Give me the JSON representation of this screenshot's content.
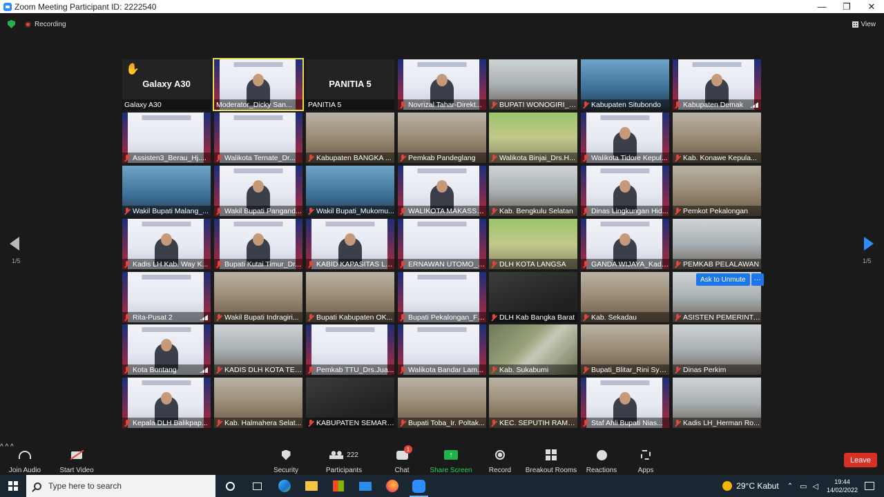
{
  "window": {
    "title": "Zoom Meeting Participant ID: 2222540",
    "minimize": "—",
    "maximize": "❐",
    "close": "✕"
  },
  "topbar": {
    "recording": "Recording",
    "view": "View"
  },
  "tiles": [
    {
      "name": "Galaxy A30",
      "center": "Galaxy A30",
      "kind": "blank",
      "hand": true,
      "muted": false
    },
    {
      "name": "Moderator_Dicky San...",
      "kind": "banner",
      "person": true,
      "muted": false,
      "highlight": true
    },
    {
      "name": "PANITIA 5",
      "center": "PANITIA 5",
      "kind": "blank",
      "muted": false
    },
    {
      "name": "Novrizal Tahar-Direkt...",
      "kind": "banner",
      "person": true,
      "muted": true
    },
    {
      "name": "BUPATI WONOGIRI_J...",
      "kind": "room2",
      "muted": true
    },
    {
      "name": "Kabupaten Situbondo",
      "kind": "blue",
      "muted": true
    },
    {
      "name": "Kabupaten Demak",
      "kind": "banner",
      "person": true,
      "muted": true,
      "net": true
    },
    {
      "name": "Assisten3_Berau_Hj....",
      "kind": "banner",
      "muted": true
    },
    {
      "name": "Walikota Ternate_Dr...",
      "kind": "banner",
      "muted": true
    },
    {
      "name": "Kabupaten BANGKA ...",
      "kind": "room",
      "muted": true
    },
    {
      "name": "Pemkab Pandeglang",
      "kind": "room",
      "muted": true
    },
    {
      "name": "Walikota Binjai_Drs.H...",
      "kind": "green",
      "muted": true
    },
    {
      "name": "Walikota Tidore Kepul...",
      "kind": "banner",
      "person": true,
      "muted": true
    },
    {
      "name": "Kab. Konawe Kepula...",
      "kind": "room",
      "muted": true
    },
    {
      "name": "Wakil Bupati Malang_...",
      "kind": "blue",
      "muted": true
    },
    {
      "name": "Wakil Bupati Pangand...",
      "kind": "banner",
      "person": true,
      "muted": true
    },
    {
      "name": "Wakil Bupati_Mukomu...",
      "kind": "blue",
      "muted": true
    },
    {
      "name": "WALIKOTA MAKASSA...",
      "kind": "banner",
      "person": true,
      "muted": true
    },
    {
      "name": "Kab. Bengkulu Selatan",
      "kind": "room2",
      "muted": true
    },
    {
      "name": "Dinas Lingkungan Hid...",
      "kind": "banner",
      "person": true,
      "muted": true
    },
    {
      "name": "Pemkot Pekalongan",
      "kind": "room",
      "muted": true
    },
    {
      "name": "Kadis LH Kab. Way K...",
      "kind": "banner",
      "person": true,
      "muted": true
    },
    {
      "name": "Bupati Kutai Timur_Dr...",
      "kind": "banner",
      "person": true,
      "muted": true
    },
    {
      "name": "KABID KAPASITAS LIN...",
      "kind": "banner",
      "person": true,
      "muted": true
    },
    {
      "name": "ERNAWAN UTOMO_Di...",
      "kind": "banner",
      "muted": true
    },
    {
      "name": "DLH KOTA LANGSA",
      "kind": "green",
      "muted": true
    },
    {
      "name": "GANDA WIJAYA_Kadis...",
      "kind": "banner",
      "person": true,
      "muted": true
    },
    {
      "name": "PEMKAB PELALAWAN",
      "kind": "room2",
      "muted": true
    },
    {
      "name": "Rita-Pusat 2",
      "kind": "banner",
      "muted": true,
      "net": true
    },
    {
      "name": "Wakil Bupati Indragiri...",
      "kind": "room",
      "muted": true
    },
    {
      "name": "Bupati Kabupaten OK...",
      "kind": "room",
      "muted": true
    },
    {
      "name": "Bupati Pekalongan_Fa...",
      "kind": "banner",
      "muted": true
    },
    {
      "name": "DLH Kab Bangka Barat",
      "kind": "dark",
      "muted": true
    },
    {
      "name": "Kab. Sekadau",
      "kind": "room",
      "muted": true
    },
    {
      "name": "ASISTEN PEMERINTA...",
      "kind": "room2",
      "muted": true
    },
    {
      "name": "Kota Bontang",
      "kind": "banner",
      "person": true,
      "muted": true,
      "net": true
    },
    {
      "name": "KADIS DLH KOTA TER...",
      "kind": "room2",
      "muted": true
    },
    {
      "name": "Pemkab TTU_Drs.Jua...",
      "kind": "banner",
      "muted": true
    },
    {
      "name": "Walikota Bandar Lam...",
      "kind": "banner",
      "muted": true
    },
    {
      "name": "Kab. Sukabumi",
      "kind": "aerial",
      "muted": true
    },
    {
      "name": "Bupati_Blitar_Rini Syar...",
      "kind": "room",
      "muted": true
    },
    {
      "name": "Dinas Perkim",
      "kind": "room2",
      "muted": true
    },
    {
      "name": "Kepala DLH Balikpap...",
      "kind": "banner",
      "person": true,
      "muted": true
    },
    {
      "name": "Kab. Halmahera Selat...",
      "kind": "room",
      "muted": true
    },
    {
      "name": "KABUPATEN SEMARA...",
      "kind": "dark",
      "muted": true
    },
    {
      "name": "Bupati Toba_Ir. Poltak...",
      "kind": "room",
      "muted": true
    },
    {
      "name": "KEC. SEPUTIH RAMAN",
      "kind": "room",
      "muted": true
    },
    {
      "name": "Staf Ahli Bupati Nias...",
      "kind": "banner",
      "person": true,
      "muted": true
    },
    {
      "name": "Kadis LH_Herman Ro...",
      "kind": "room2",
      "muted": true
    }
  ],
  "ask_unmute": "Ask to Unmute",
  "ask_more": "···",
  "pagination": {
    "left": "1/5",
    "right": "1/5"
  },
  "toolbar": {
    "join_audio": "Join Audio",
    "start_video": "Start Video",
    "security": "Security",
    "participants": "Participants",
    "participants_count": "222",
    "chat": "Chat",
    "chat_badge": "1",
    "share_screen": "Share Screen",
    "record": "Record",
    "breakout_rooms": "Breakout Rooms",
    "reactions": "Reactions",
    "apps": "Apps",
    "leave": "Leave",
    "caret": "^"
  },
  "taskbar": {
    "search_placeholder": "Type here to search",
    "weather": "29°C Kabut",
    "time": "19:44",
    "date": "14/02/2022"
  },
  "colors": {
    "zoom_blue": "#2d8cff",
    "share_green": "#22b14c",
    "leave_red": "#d93025",
    "highlight": "#e8e14a"
  }
}
